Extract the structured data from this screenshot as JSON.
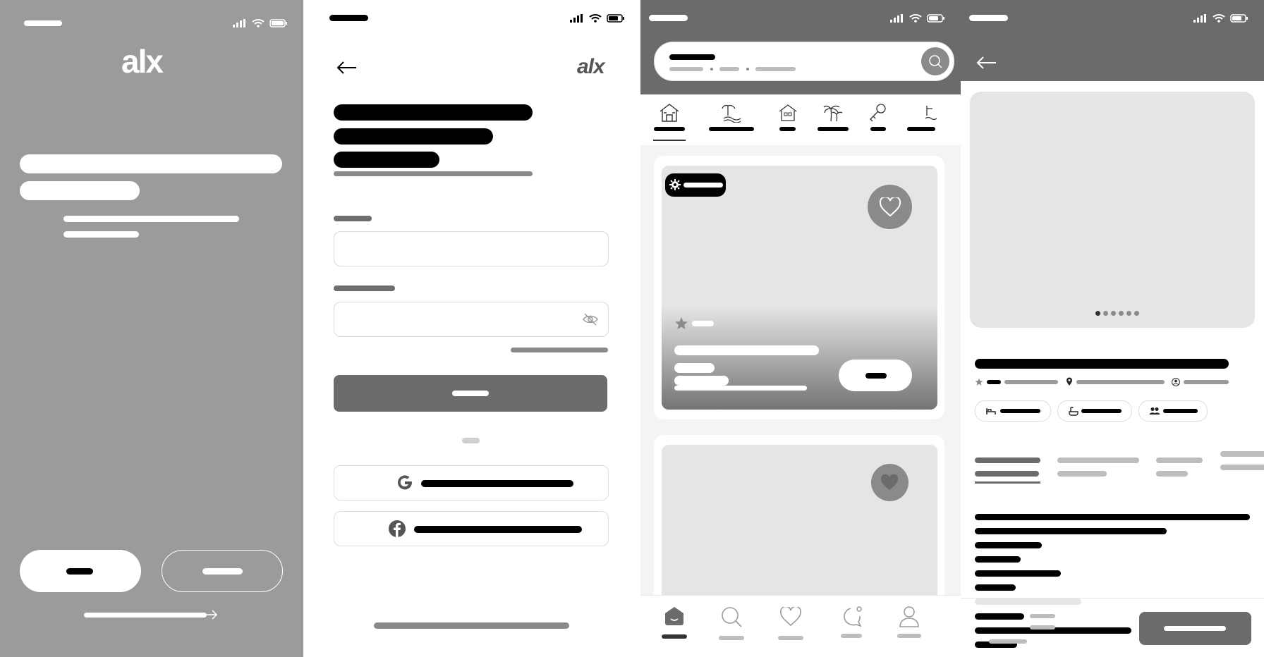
{
  "brand": {
    "logo_text": "alx"
  },
  "icons": {
    "back": "back-arrow-icon",
    "search": "search-icon",
    "heart": "heart-icon",
    "eye_off": "eye-off-icon",
    "google": "google-icon",
    "facebook": "facebook-icon",
    "star": "star-icon",
    "location": "location-pin-icon",
    "user": "user-icon",
    "bed": "bed-icon",
    "bath": "bath-icon",
    "guests": "guests-icon",
    "arrow_right": "arrow-right-icon",
    "gear_badge": "gear-badge-icon"
  },
  "colors": {
    "splash_bg": "#9b9b9b",
    "header_dark": "#6b6b6b",
    "primary_button": "#6b6b6b",
    "placeholder_bar": "#000000",
    "card_image": "#e5e5e5"
  },
  "explore": {
    "categories": [
      "category-1",
      "category-2",
      "category-3",
      "category-4",
      "category-5",
      "category-6"
    ],
    "selected_category_index": 0
  },
  "detail": {
    "carousel_dots": 6,
    "active_dot_index": 0
  },
  "bottom_nav": [
    "home",
    "search",
    "wishlist",
    "messages",
    "profile"
  ],
  "active_nav_index": 0
}
